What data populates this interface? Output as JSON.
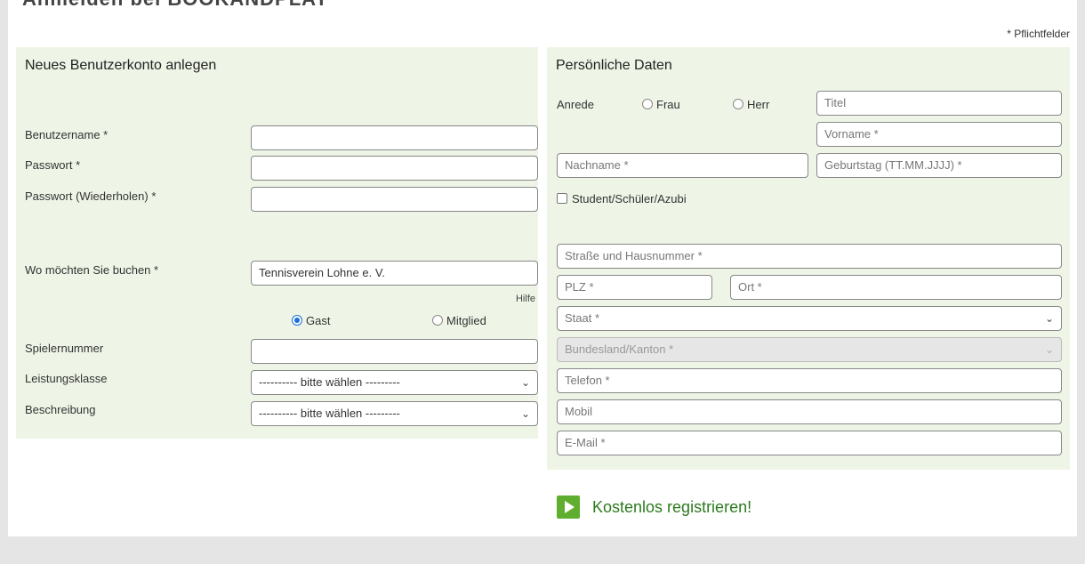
{
  "page": {
    "title_cut": "Anmelden bei BOOKANDPLAY"
  },
  "required_note": "* Pflichtfelder",
  "account": {
    "heading": "Neues Benutzerkonto anlegen",
    "username_label": "Benutzername *",
    "username_value": "",
    "password_label": "Passwort *",
    "password_value": "",
    "password_repeat_label": "Passwort (Wiederholen) *",
    "password_repeat_value": "",
    "venue_label": "Wo möchten Sie buchen *",
    "venue_value": "Tennisverein Lohne e. V.",
    "help_link": "Hilfe",
    "role_options": [
      {
        "label": "Gast",
        "selected": true
      },
      {
        "label": "Mitglied",
        "selected": false
      }
    ],
    "player_number_label": "Spielernummer",
    "player_number_value": "",
    "level_label": "Leistungsklasse",
    "level_value": "---------- bitte wählen ---------",
    "description_label": "Beschreibung",
    "description_value": "---------- bitte wählen ---------"
  },
  "personal": {
    "heading": "Persönliche Daten",
    "salutation_label": "Anrede",
    "salutation_options": [
      {
        "label": "Frau",
        "selected": false
      },
      {
        "label": "Herr",
        "selected": false
      }
    ],
    "title_placeholder": "Titel",
    "firstname_placeholder": "Vorname *",
    "lastname_placeholder": "Nachname *",
    "birthday_placeholder": "Geburtstag (TT.MM.JJJJ) *",
    "student_label": "Student/Schüler/Azubi",
    "student_checked": false,
    "street_placeholder": "Straße und Hausnummer *",
    "zip_placeholder": "PLZ *",
    "city_placeholder": "Ort *",
    "country_placeholder": "Staat *",
    "state_placeholder": "Bundesland/Kanton *",
    "phone_placeholder": "Telefon *",
    "mobile_placeholder": "Mobil",
    "email_placeholder": "E-Mail *"
  },
  "submit": {
    "label": "Kostenlos registrieren!",
    "icon": "play-icon"
  },
  "colors": {
    "panel_bg": "#eef5e6",
    "accent_green": "#5fae2f",
    "submit_text": "#2d7a1f"
  }
}
